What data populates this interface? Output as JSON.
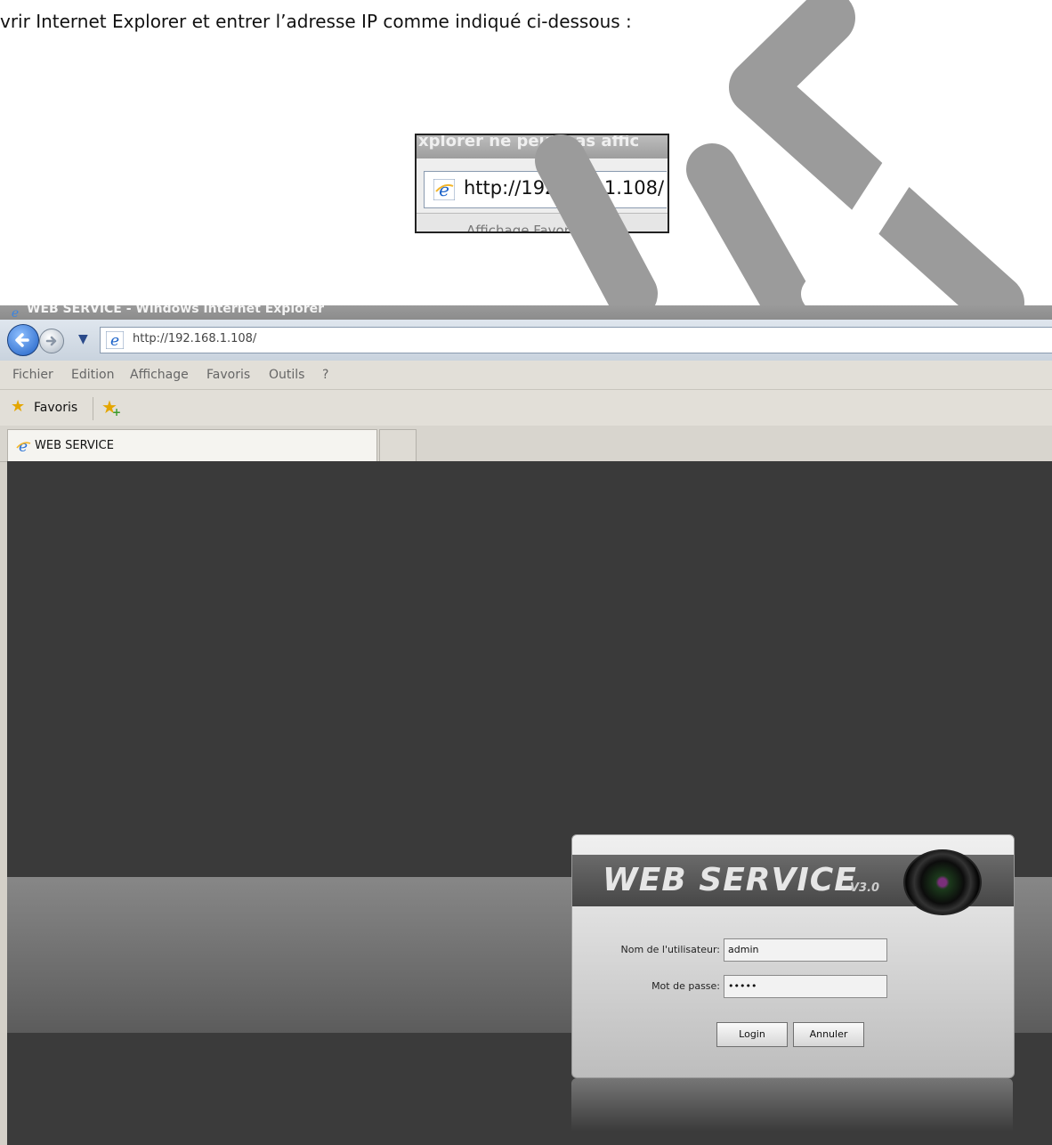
{
  "intro_text": "vrir Internet Explorer et entrer l’adresse IP comme indiqué ci-dessous :",
  "zoom_inset": {
    "top_fragment": "xplorer ne peut pas affic",
    "address_url": "http://192.168.1.108/",
    "bottom_fragment": "Affichage      Favoris"
  },
  "browser": {
    "title": "WEB SERVICE - Windows Internet Explorer",
    "address_url": "http://192.168.1.108/",
    "menu": [
      "Fichier",
      "Edition",
      "Affichage",
      "Favoris",
      "Outils",
      "?"
    ],
    "favorites_label": "Favoris",
    "tab_label": "WEB SERVICE"
  },
  "login_panel": {
    "banner_title": "WEB  SERVICE",
    "banner_version": "V3.0",
    "username_label": "Nom de l'utilisateur:",
    "username_value": "admin",
    "password_label": "Mot de passe:",
    "password_value": "•••••",
    "login_button": "Login",
    "cancel_button": "Annuler"
  },
  "colors": {
    "watermark": "#9b9b9b",
    "page_background": "#3a3a3a",
    "chrome": "#d4d0c8"
  },
  "icons": [
    "ie-logo-icon",
    "back-arrow-icon",
    "forward-arrow-icon",
    "dropdown-icon",
    "favorites-star-icon",
    "add-favorite-icon",
    "camera-lens-icon"
  ]
}
